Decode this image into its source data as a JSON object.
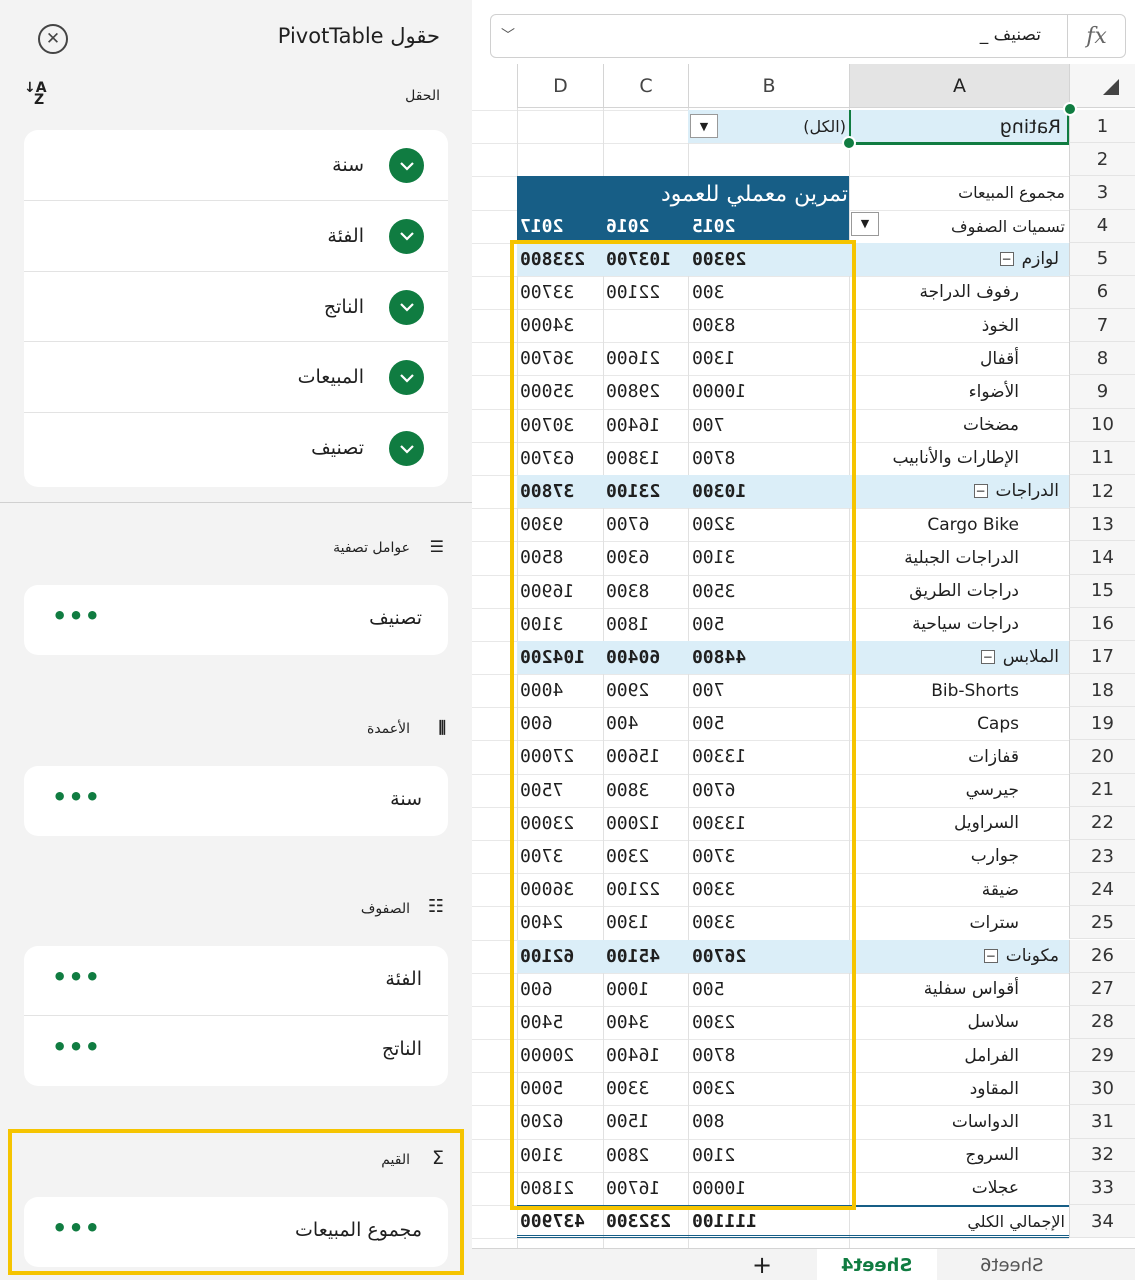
{
  "pane": {
    "title": "حقول PivotTable",
    "fields_label": "الحقل",
    "fields": [
      "سنة",
      "الفئة",
      "الناتج",
      "المبيعات",
      "تصنيف"
    ],
    "filters_label": "عوامل تصفية",
    "filters": [
      "تصنيف"
    ],
    "columns_label": "الأعمدة",
    "columns": [
      "سنة"
    ],
    "rows_label": "الصفوف",
    "rows": [
      "الفئة",
      "الناتج"
    ],
    "values_label": "القيم",
    "values": [
      "مجموع المبيعات"
    ],
    "more": "•••",
    "accent_color": "#107c41",
    "highlight_color": "#f5c400"
  },
  "formula_bar": {
    "fx": "fx",
    "value": "تصنيف _"
  },
  "columns": [
    "A",
    "B",
    "C",
    "D"
  ],
  "pivot": {
    "filter_label": "Rating",
    "filter_value": "(الكل)",
    "values_header": "مجموع المبيعات",
    "column_title": "تمرين معملي للعمود",
    "row_labels_header": "تسميات الصفوف",
    "years": [
      "2015",
      "2016",
      "2017"
    ],
    "rows": [
      {
        "label": "لوازم",
        "group": true,
        "v": [
          "29300",
          "103700",
          "233800"
        ]
      },
      {
        "label": "رفوف الدراجة",
        "v": [
          "300",
          "22100",
          "33700"
        ]
      },
      {
        "label": "الخوذ",
        "v": [
          "8300",
          "",
          "34000"
        ]
      },
      {
        "label": "أقفال",
        "v": [
          "1300",
          "21600",
          "36700"
        ]
      },
      {
        "label": "الأضواء",
        "v": [
          "10000",
          "29800",
          "35000"
        ]
      },
      {
        "label": "مضخات",
        "v": [
          "700",
          "16400",
          "30700"
        ]
      },
      {
        "label": "الإطارات والأنابيب",
        "v": [
          "8700",
          "13800",
          "63700"
        ]
      },
      {
        "label": "الدراجات",
        "group": true,
        "v": [
          "10300",
          "23100",
          "37800"
        ]
      },
      {
        "label": "Cargo Bike",
        "v": [
          "3200",
          "6700",
          "9300"
        ]
      },
      {
        "label": "الدراجات الجبلية",
        "v": [
          "3100",
          "6300",
          "8500"
        ]
      },
      {
        "label": "دراجات الطريق",
        "v": [
          "3500",
          "8300",
          "16900"
        ]
      },
      {
        "label": "دراجات سياحية",
        "v": [
          "500",
          "1800",
          "3100"
        ]
      },
      {
        "label": "الملابس",
        "group": true,
        "v": [
          "44800",
          "60400",
          "104200"
        ]
      },
      {
        "label": "Bib-Shorts",
        "v": [
          "700",
          "2900",
          "4000"
        ]
      },
      {
        "label": "Caps",
        "v": [
          "500",
          "400",
          "600"
        ]
      },
      {
        "label": "قفازات",
        "v": [
          "13300",
          "15600",
          "27000"
        ]
      },
      {
        "label": "جيرسي",
        "v": [
          "6700",
          "3800",
          "7500"
        ]
      },
      {
        "label": "السراويل",
        "v": [
          "13300",
          "12000",
          "23000"
        ]
      },
      {
        "label": "جوارب",
        "v": [
          "3700",
          "2300",
          "3700"
        ]
      },
      {
        "label": "ضيقة",
        "v": [
          "3300",
          "22100",
          "36000"
        ]
      },
      {
        "label": "سترات",
        "v": [
          "3300",
          "1300",
          "2400"
        ]
      },
      {
        "label": "مكونات",
        "group": true,
        "v": [
          "26700",
          "45100",
          "62100"
        ]
      },
      {
        "label": "أقواس سفلية",
        "v": [
          "500",
          "1000",
          "600"
        ]
      },
      {
        "label": "سلاسل",
        "v": [
          "2300",
          "3400",
          "5400"
        ]
      },
      {
        "label": "الفرامل",
        "v": [
          "8700",
          "16400",
          "20000"
        ]
      },
      {
        "label": "المقاود",
        "v": [
          "2300",
          "3300",
          "5000"
        ]
      },
      {
        "label": "الدواسات",
        "v": [
          "800",
          "1500",
          "6200"
        ]
      },
      {
        "label": "السروج",
        "v": [
          "2100",
          "2800",
          "3100"
        ]
      },
      {
        "label": "عجلات",
        "v": [
          "10000",
          "16700",
          "21800"
        ]
      }
    ],
    "grand_total_label": "الإجمالي الكلي",
    "grand_total": [
      "111100",
      "232300",
      "437900"
    ],
    "header_color": "#175e86",
    "band_color": "#dbeef8"
  },
  "row_numbers": [
    "1",
    "2",
    "3",
    "4",
    "5",
    "6",
    "7",
    "8",
    "9",
    "10",
    "11",
    "12",
    "13",
    "14",
    "15",
    "16",
    "17",
    "18",
    "19",
    "20",
    "21",
    "22",
    "23",
    "24",
    "25",
    "26",
    "27",
    "28",
    "29",
    "30",
    "31",
    "32",
    "33",
    "34"
  ],
  "sheets": {
    "add": "+",
    "active": "Sheet4",
    "other": "Sheet6"
  }
}
